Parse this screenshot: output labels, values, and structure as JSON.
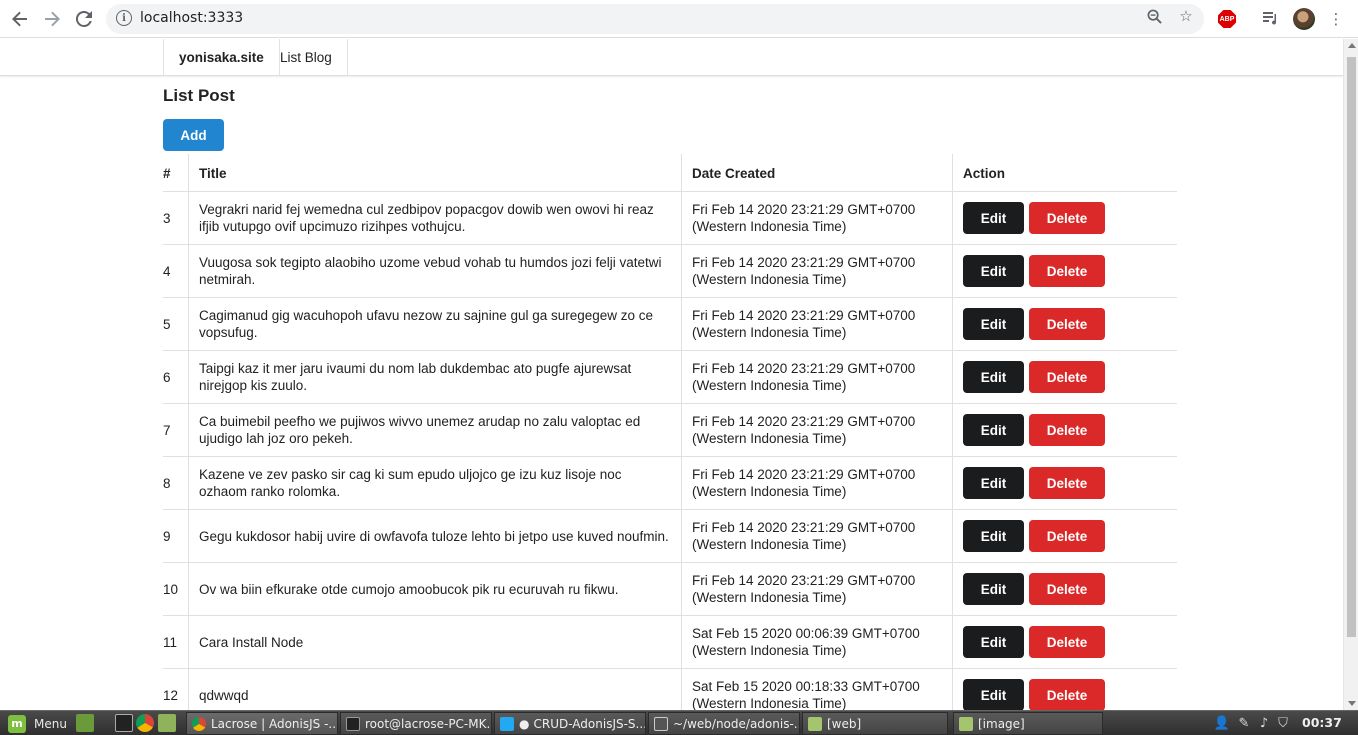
{
  "browser": {
    "url": "localhost:3333"
  },
  "nav": {
    "brand": "yonisaka.site",
    "list_blog": "List Blog"
  },
  "page": {
    "heading": "List Post",
    "add_label": "Add"
  },
  "table": {
    "headers": {
      "num": "#",
      "title": "Title",
      "date": "Date Created",
      "action": "Action"
    },
    "edit_label": "Edit",
    "delete_label": "Delete",
    "rows": [
      {
        "id": "3",
        "title": "Vegrakri narid fej wemedna cul zedbipov popacgov dowib wen owovi hi reaz ifjib vutupgo ovif upcimuzo rizihpes vothujcu.",
        "date_line1": "Fri Feb 14 2020 23:21:29 GMT+0700",
        "date_line2": "(Western Indonesia Time)"
      },
      {
        "id": "4",
        "title": "Vuugosa sok tegipto alaobiho uzome vebud vohab tu humdos jozi felji vatetwi netmirah.",
        "date_line1": "Fri Feb 14 2020 23:21:29 GMT+0700",
        "date_line2": "(Western Indonesia Time)"
      },
      {
        "id": "5",
        "title": "Cagimanud gig wacuhopoh ufavu nezow zu sajnine gul ga suregegew zo ce vopsufug.",
        "date_line1": "Fri Feb 14 2020 23:21:29 GMT+0700",
        "date_line2": "(Western Indonesia Time)"
      },
      {
        "id": "6",
        "title": "Taipgi kaz it mer jaru ivaumi du nom lab dukdembac ato pugfe ajurewsat nirejgop kis zuulo.",
        "date_line1": "Fri Feb 14 2020 23:21:29 GMT+0700",
        "date_line2": "(Western Indonesia Time)"
      },
      {
        "id": "7",
        "title": "Ca buimebil peefho we pujiwos wivvo unemez arudap no zalu valoptac ed ujudigo lah joz oro pekeh.",
        "date_line1": "Fri Feb 14 2020 23:21:29 GMT+0700",
        "date_line2": "(Western Indonesia Time)"
      },
      {
        "id": "8",
        "title": "Kazene ve zev pasko sir cag ki sum epudo uljojco ge izu kuz lisoje noc ozhaom ranko rolomka.",
        "date_line1": "Fri Feb 14 2020 23:21:29 GMT+0700",
        "date_line2": "(Western Indonesia Time)"
      },
      {
        "id": "9",
        "title": "Gegu kukdosor habij uvire di owfavofa tuloze lehto bi jetpo use kuved noufmin.",
        "date_line1": "Fri Feb 14 2020 23:21:29 GMT+0700",
        "date_line2": "(Western Indonesia Time)"
      },
      {
        "id": "10",
        "title": "Ov wa biin efkurake otde cumojo amoobucok pik ru ecuruvah ru fikwu.",
        "date_line1": "Fri Feb 14 2020 23:21:29 GMT+0700",
        "date_line2": "(Western Indonesia Time)"
      },
      {
        "id": "11",
        "title": "Cara Install Node",
        "date_line1": "Sat Feb 15 2020 00:06:39 GMT+0700",
        "date_line2": "(Western Indonesia Time)"
      },
      {
        "id": "12",
        "title": "qdwwqd",
        "date_line1": "Sat Feb 15 2020 00:18:33 GMT+0700",
        "date_line2": "(Western Indonesia Time)"
      }
    ]
  },
  "taskbar": {
    "menu_label": "Menu",
    "tasks": [
      "Lacrose | AdonisJS -...",
      "root@lacrose-PC-MK...",
      "CRUD-AdonisJS-S...",
      "~/web/node/adonis-...",
      "[web]",
      "[image]"
    ],
    "clock": "00:37"
  },
  "colors": {
    "primary": "#2185d0",
    "dark": "#1b1c1d",
    "danger": "#db2828"
  }
}
